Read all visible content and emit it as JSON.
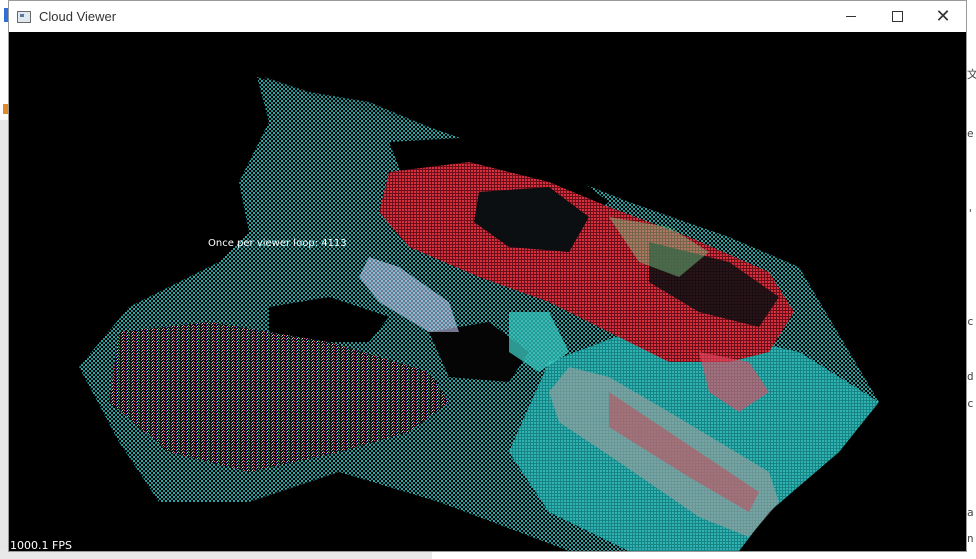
{
  "window": {
    "title": "Cloud Viewer",
    "controls": {
      "minimize": "minimize-icon",
      "maximize": "maximize-icon",
      "close": "close-icon"
    }
  },
  "viewer": {
    "loop_text": "Once per viewer loop: 4113",
    "fps_text": "1000.1 FPS"
  },
  "colors": {
    "background": "#000000",
    "cloud_cyan": "#2aa7a6",
    "cloud_red": "#d0283a",
    "titlebar": "#ffffff"
  }
}
